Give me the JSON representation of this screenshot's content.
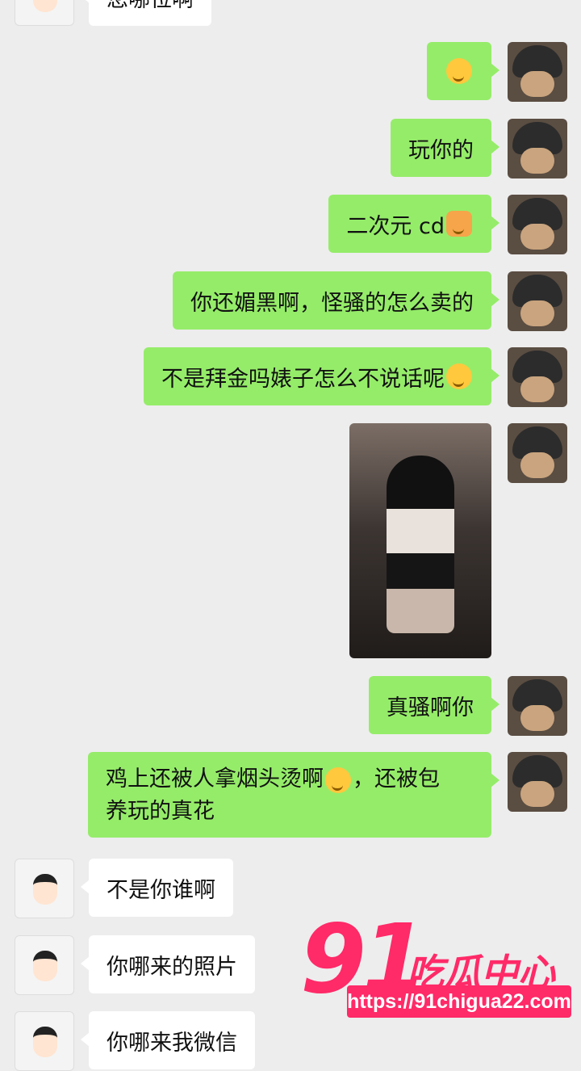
{
  "messages": {
    "m0": "您哪位啊",
    "m2": "玩你的",
    "m3_text": "二次元 cd",
    "m4": "你还媚黑啊，怪骚的怎么卖的",
    "m5_text": "不是拜金吗婊子怎么不说话呢",
    "m7": "真骚啊你",
    "m8_line1": "鸡上还被人拿烟头烫啊",
    "m8_line1_tail": "，还被包",
    "m8_line2": "养玩的真花",
    "m9": "不是你谁啊",
    "m10": "你哪来的照片",
    "m11": "你哪来我微信"
  },
  "icons": {
    "thinking": "thinking-face-emoji",
    "cat": "cat-face-emoji",
    "avatar_me": "hamster-helmet-avatar",
    "avatar_other": "cartoon-girl-avatar"
  },
  "watermark": {
    "number": "91",
    "text": "吃瓜中心",
    "url": "https://91chigua22.com"
  },
  "colors": {
    "sent_bubble": "#95ec69",
    "received_bubble": "#ffffff",
    "background": "#ededed",
    "watermark": "#ff2a68"
  }
}
